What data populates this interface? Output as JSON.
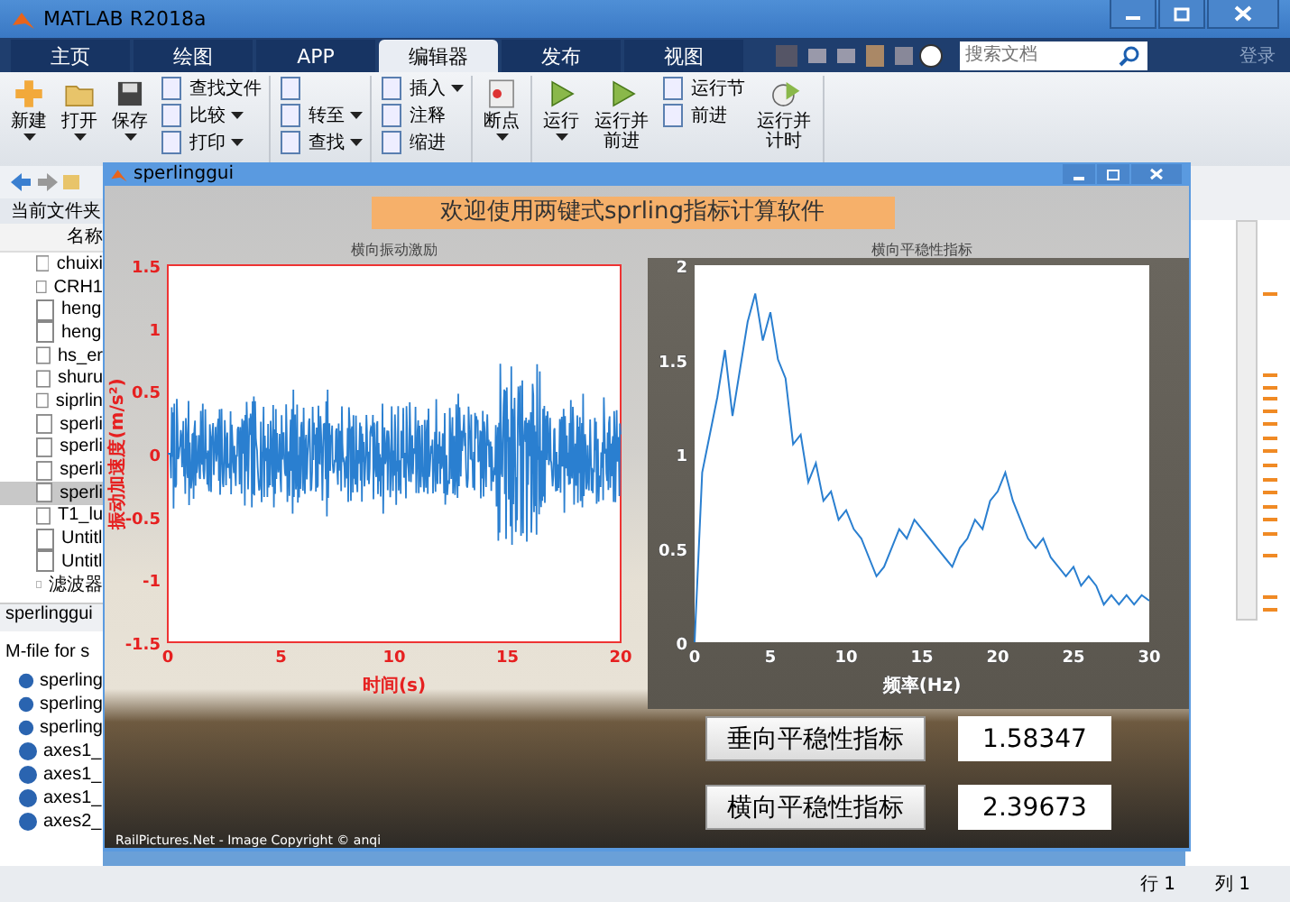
{
  "window": {
    "title": "MATLAB R2018a"
  },
  "ribbon_tabs": [
    {
      "label": "主页",
      "selected": false
    },
    {
      "label": "绘图",
      "selected": false
    },
    {
      "label": "APP",
      "selected": false
    },
    {
      "label": "编辑器",
      "selected": true
    },
    {
      "label": "发布",
      "selected": false
    },
    {
      "label": "视图",
      "selected": false
    }
  ],
  "search": {
    "placeholder": "搜索文档"
  },
  "sign_in": "登录",
  "toolbar": [
    [
      {
        "kind": "large",
        "label": "新建",
        "dropdown": true
      },
      {
        "kind": "large",
        "label": "打开",
        "dropdown": true
      },
      {
        "kind": "large",
        "label": "保存",
        "dropdown": true
      },
      {
        "kind": "stack",
        "items": [
          {
            "label": "查找文件",
            "dropdown": false
          },
          {
            "label": "比较",
            "dropdown": true
          },
          {
            "label": "打印",
            "dropdown": true
          }
        ]
      }
    ],
    [
      {
        "kind": "stack",
        "items": [
          {
            "dropdown": false
          },
          {
            "label": "转至",
            "dropdown": true
          },
          {
            "label": "查找",
            "dropdown": true
          }
        ]
      }
    ],
    [
      {
        "kind": "stack",
        "items": [
          {
            "label": "插入",
            "dropdown": true
          },
          {
            "label": "注释",
            "dropdown": false
          },
          {
            "label": "缩进",
            "dropdown": false
          }
        ]
      }
    ],
    [
      {
        "kind": "large",
        "label": "断点",
        "dropdown": true
      }
    ],
    [
      {
        "kind": "large",
        "label": "运行",
        "dropdown": true
      },
      {
        "kind": "large",
        "label": "运行并前进",
        "dropdown": false
      },
      {
        "kind": "stack",
        "items": [
          {
            "label": "运行节",
            "dropdown": false
          },
          {
            "label": "前进",
            "dropdown": false
          }
        ]
      },
      {
        "kind": "large",
        "label": "运行并计时",
        "dropdown": false
      }
    ]
  ],
  "file_browser": {
    "header": "当前文件夹",
    "column": "名称",
    "files": [
      {
        "name": "chuixi",
        "selected": false
      },
      {
        "name": "CRH1",
        "selected": false
      },
      {
        "name": "heng",
        "selected": false
      },
      {
        "name": "heng",
        "selected": false
      },
      {
        "name": "hs_er",
        "selected": false
      },
      {
        "name": "shuru",
        "selected": false
      },
      {
        "name": "siprlin",
        "selected": false
      },
      {
        "name": "sperli",
        "selected": false
      },
      {
        "name": "sperli",
        "selected": false
      },
      {
        "name": "sperli",
        "selected": false
      },
      {
        "name": "sperli",
        "selected": true
      },
      {
        "name": "T1_lu",
        "selected": false
      },
      {
        "name": "Untitl",
        "selected": false
      },
      {
        "name": "Untitl",
        "selected": false
      },
      {
        "name": "滤波器",
        "selected": false
      }
    ]
  },
  "details": {
    "title": "sperlinggui",
    "description": "M-file for s",
    "items": [
      "sperling",
      "sperling",
      "sperling",
      "axes1_",
      "axes1_",
      "axes1_",
      "axes2_"
    ]
  },
  "status_bar": {
    "row": "行 1",
    "column": "列 1"
  },
  "figure": {
    "title": "sperlinggui",
    "banner": "欢迎使用两键式sprling指标计算软件",
    "left_axes": {
      "title": "横向振动激励",
      "ylabel": "振动加速度(m/s²)",
      "xlabel": "时间(s)",
      "yticks": [
        "1.5",
        "1",
        "0.5",
        "0",
        "-0.5",
        "-1",
        "-1.5"
      ],
      "xticks": [
        "0",
        "5",
        "10",
        "15",
        "20"
      ]
    },
    "right_axes": {
      "chart_data": {
        "type": "line",
        "title": "横向平稳性指标",
        "xlabel": "频率(Hz)",
        "x": [
          0,
          0.5,
          1,
          1.5,
          2,
          2.5,
          3,
          3.5,
          4,
          4.5,
          5,
          5.5,
          6,
          6.5,
          7,
          7.5,
          8,
          8.5,
          9,
          9.5,
          10,
          10.5,
          11,
          11.5,
          12,
          12.5,
          13,
          13.5,
          14,
          14.5,
          15,
          15.5,
          16,
          16.5,
          17,
          17.5,
          18,
          18.5,
          19,
          19.5,
          20,
          20.5,
          21,
          21.5,
          22,
          22.5,
          23,
          23.5,
          24,
          24.5,
          25,
          25.5,
          26,
          26.5,
          27,
          27.5,
          28,
          28.5,
          29,
          29.5,
          30
        ],
        "series": [
          {
            "color": "#2a7fd0",
            "values": [
              0,
              0.9,
              1.1,
              1.3,
              1.55,
              1.2,
              1.45,
              1.7,
              1.85,
              1.6,
              1.75,
              1.5,
              1.4,
              1.05,
              1.1,
              0.85,
              0.95,
              0.75,
              0.8,
              0.65,
              0.7,
              0.6,
              0.55,
              0.45,
              0.35,
              0.4,
              0.5,
              0.6,
              0.55,
              0.65,
              0.6,
              0.55,
              0.5,
              0.45,
              0.4,
              0.5,
              0.55,
              0.65,
              0.6,
              0.75,
              0.8,
              0.9,
              0.75,
              0.65,
              0.55,
              0.5,
              0.55,
              0.45,
              0.4,
              0.35,
              0.4,
              0.3,
              0.35,
              0.3,
              0.2,
              0.25,
              0.2,
              0.25,
              0.2,
              0.25,
              0.22
            ]
          }
        ],
        "xlim": [
          0,
          30
        ],
        "ylim": [
          0,
          2
        ],
        "xticks": [
          0,
          5,
          10,
          15,
          20,
          25,
          30
        ],
        "yticks": [
          0,
          0.5,
          1,
          1.5,
          2
        ]
      }
    },
    "results": [
      {
        "button": "垂向平稳性指标",
        "value": "1.58347"
      },
      {
        "button": "横向平稳性指标",
        "value": "2.39673"
      }
    ],
    "photo_credit": "RailPictures.Net - Image Copyright © anqi"
  }
}
